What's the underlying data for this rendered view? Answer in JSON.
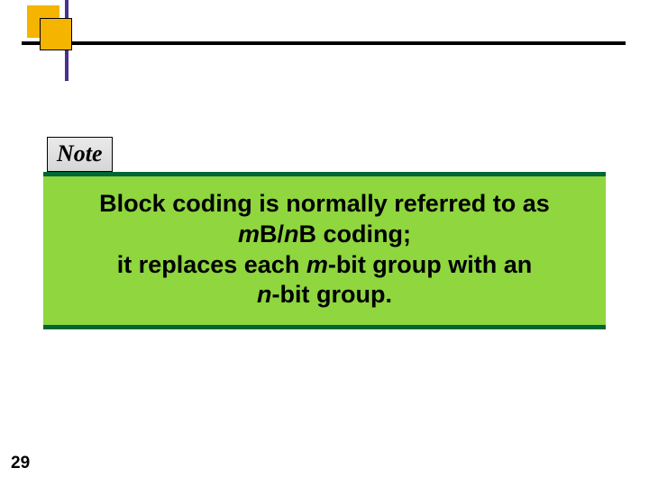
{
  "note_label": "Note",
  "callout": {
    "line1_pre": "Block coding is normally referred to as",
    "line2_em_m": "m",
    "line2_mid1": "B/",
    "line2_em_n": "n",
    "line2_mid2": "B coding;",
    "line3_pre": "it replaces each ",
    "line3_em_m": "m",
    "line3_post": "-bit group with an",
    "line4_em_n": "n",
    "line4_post": "-bit group."
  },
  "page_number": "29"
}
